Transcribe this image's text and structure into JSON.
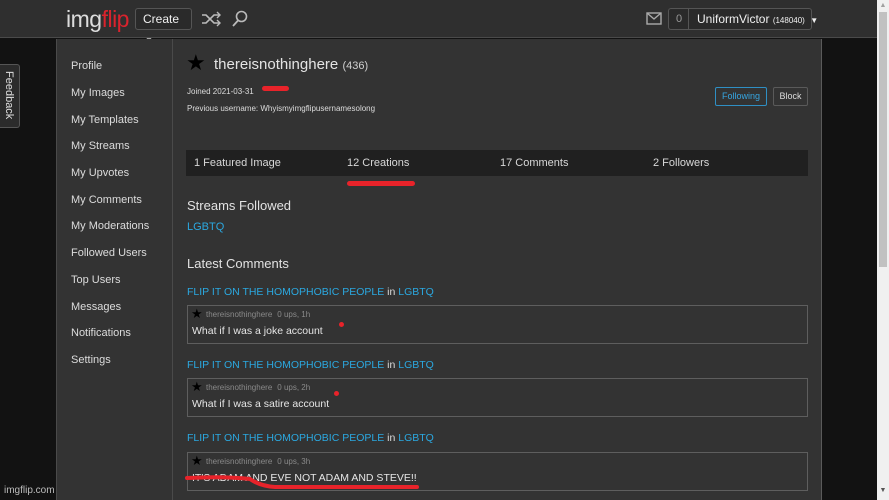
{
  "header": {
    "logo_part1": "img",
    "logo_part2": "flip",
    "create_label": "Create",
    "caret": "▼",
    "notification_count": "0",
    "username": "UniformVictor",
    "user_points": "(148040)"
  },
  "feedback_label": "Feedback",
  "sidebar": {
    "items": [
      {
        "label": "Profile"
      },
      {
        "label": "My Images"
      },
      {
        "label": "My Templates"
      },
      {
        "label": "My Streams"
      },
      {
        "label": "My Upvotes"
      },
      {
        "label": "My Comments"
      },
      {
        "label": "My Moderations"
      },
      {
        "label": "Followed Users"
      },
      {
        "label": "Top Users"
      },
      {
        "label": "Messages"
      },
      {
        "label": "Notifications"
      },
      {
        "label": "Settings"
      }
    ]
  },
  "profile": {
    "star": "★",
    "username": "thereisnothinghere",
    "points": "(436)",
    "joined": "Joined 2021-03-31",
    "previous_username": "Previous username: Whyismyimgflipusernamesolong",
    "following_label": "Following",
    "block_label": "Block"
  },
  "stats": [
    {
      "label": "1 Featured Image"
    },
    {
      "label": "12 Creations"
    },
    {
      "label": "17 Comments"
    },
    {
      "label": "2 Followers"
    }
  ],
  "streams_followed": {
    "title": "Streams Followed",
    "items": [
      "LGBTQ"
    ]
  },
  "latest_comments": {
    "title": "Latest Comments",
    "connector": "in",
    "items": [
      {
        "post_title": "FLIP IT ON THE HOMOPHOBIC PEOPLE",
        "stream": "LGBTQ",
        "author": "thereisnothinghere",
        "meta": "0 ups, 1h",
        "text": "What if I was a joke account"
      },
      {
        "post_title": "FLIP IT ON THE HOMOPHOBIC PEOPLE",
        "stream": "LGBTQ",
        "author": "thereisnothinghere",
        "meta": "0 ups, 2h",
        "text": "What if I was a satire account"
      },
      {
        "post_title": "FLIP IT ON THE HOMOPHOBIC PEOPLE",
        "stream": "LGBTQ",
        "author": "thereisnothinghere",
        "meta": "0 ups, 3h",
        "text": "IT'S ADAM AND EVE NOT ADAM AND STEVE!!"
      }
    ]
  },
  "watermark": "imgflip.com",
  "colors": {
    "accent_link": "#2ba8e0",
    "brand_red": "#d9232d",
    "annotation_red": "#e8232a"
  }
}
